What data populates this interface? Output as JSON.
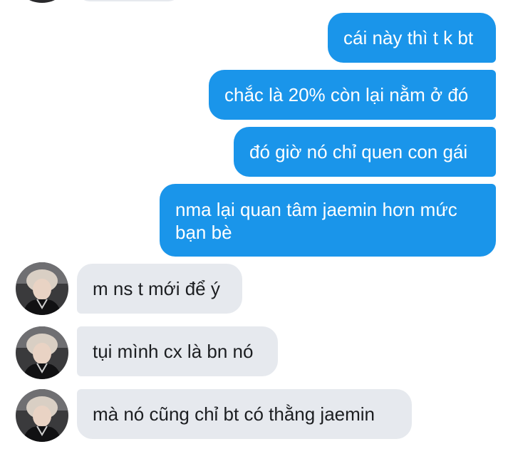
{
  "conversation": {
    "outgoing": [
      "cái này thì t k bt",
      "chắc là 20% còn lại nằm ở đó",
      "đó giờ nó chỉ quen con gái",
      "nma lại quan tâm jaemin hơn mức bạn bè"
    ],
    "incoming": [
      "m ns t mới để ý",
      "tụi mình cx là bn nó",
      "mà nó cũng chỉ bt có thằng jaemin"
    ]
  },
  "colors": {
    "outgoing_bubble": "#1a95ea",
    "incoming_bubble": "#e6e9ee",
    "outgoing_text": "#ffffff",
    "incoming_text": "#1c1e21"
  }
}
